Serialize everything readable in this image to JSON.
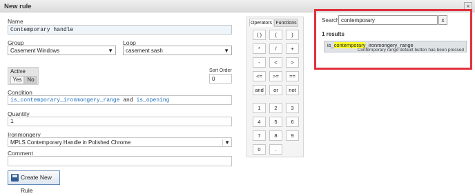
{
  "window": {
    "title": "New rule",
    "close_label": "×"
  },
  "form": {
    "name_label": "Name",
    "name_value": "Contemporary handle",
    "group_label": "Group",
    "group_value": "Casement Windows",
    "loop_label": "Loop",
    "loop_value": "casement sash",
    "active_label": "Active",
    "active_yes": "Yes",
    "active_no": "No",
    "sort_order_label": "Sort Order",
    "sort_order_value": "0",
    "condition_label": "Condition",
    "condition_part1": "is_contemporary_ironmongery_range",
    "condition_op": " and ",
    "condition_part2": "is_opening",
    "quantity_label": "Quantity",
    "quantity_value": "1",
    "ironmongery_label": "Ironmongery",
    "ironmongery_value": "MPLS Contemporary Handle in Polished Chrome",
    "comment_label": "Comment",
    "comment_value": "",
    "create_label": "Create New Rule"
  },
  "operators": {
    "tab_operators": "Operators",
    "tab_functions": "Functions",
    "keys_top": [
      "( )",
      "(",
      ")",
      "*",
      "/",
      "+",
      "-",
      "<",
      ">",
      "<=",
      ">=",
      "==",
      "and",
      "or",
      "not"
    ],
    "keys_num": [
      "1",
      "2",
      "3",
      "4",
      "5",
      "6",
      "7",
      "8",
      "9",
      "0",
      "."
    ]
  },
  "search": {
    "label": "Search:",
    "value": "contemporary",
    "clear_label": "x",
    "results_count": "1 results",
    "result_prefix": "is_",
    "result_match": "contemporary",
    "result_suffix": "_ironmongery_range",
    "result_desc": "Contemporary range default button has been pressed"
  },
  "colors": {
    "highlight_box": "#e0303a",
    "match_highlight": "#ffff2a",
    "accent": "#2f5c92"
  }
}
